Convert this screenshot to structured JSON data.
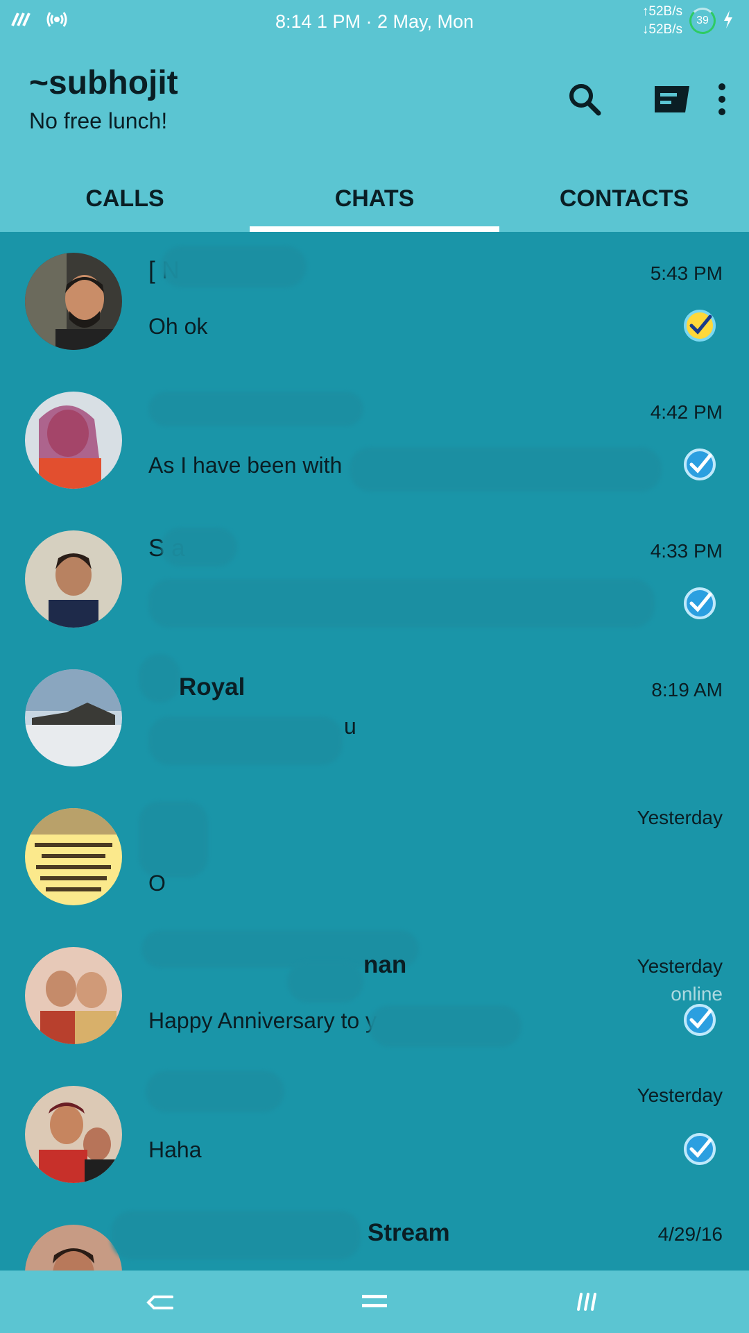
{
  "status_bar": {
    "time_date": "8:14 1 PM · 2 May, Mon",
    "upload_speed": "↑52B/s",
    "download_speed": "↓52B/s",
    "battery": "39"
  },
  "header": {
    "title": "~subhojit",
    "subtitle": "No free lunch!",
    "icons": [
      "search-icon",
      "new-chat-icon",
      "more-vert-icon"
    ]
  },
  "tabs": [
    {
      "label": "CALLS",
      "selected": false
    },
    {
      "label": "CHATS",
      "selected": true
    },
    {
      "label": "CONTACTS",
      "selected": false
    }
  ],
  "chats": [
    {
      "name": "[ N",
      "time": "5:43 PM",
      "preview": "Oh ok",
      "status": "",
      "check": "read"
    },
    {
      "name": "",
      "time": "4:42 PM",
      "preview": "As I have been with",
      "status": "",
      "check": "delivered"
    },
    {
      "name": "S a",
      "time": "4:33 PM",
      "preview": "",
      "status": "",
      "check": "delivered"
    },
    {
      "name": "Royal",
      "time": "8:19 AM",
      "preview": "u",
      "status": "",
      "check": ""
    },
    {
      "name": "",
      "time": "Yesterday",
      "preview": "O",
      "status": "",
      "check": ""
    },
    {
      "name": "nan",
      "time": "Yesterday",
      "preview": "Happy Anniversary to y",
      "status": "online",
      "check": "delivered"
    },
    {
      "name": "",
      "time": "Yesterday",
      "preview": "Haha",
      "status": "",
      "check": "delivered"
    },
    {
      "name": "Stream",
      "time": "4/29/16",
      "preview": "",
      "status": "",
      "check": ""
    }
  ],
  "nav": [
    "back-icon",
    "home-icon",
    "recents-icon"
  ],
  "colors": {
    "header_bg": "#5bc5d2",
    "list_bg": "#1a95a8",
    "check_read": "#ffd83a",
    "check_delivered": "#2b9fe0"
  }
}
